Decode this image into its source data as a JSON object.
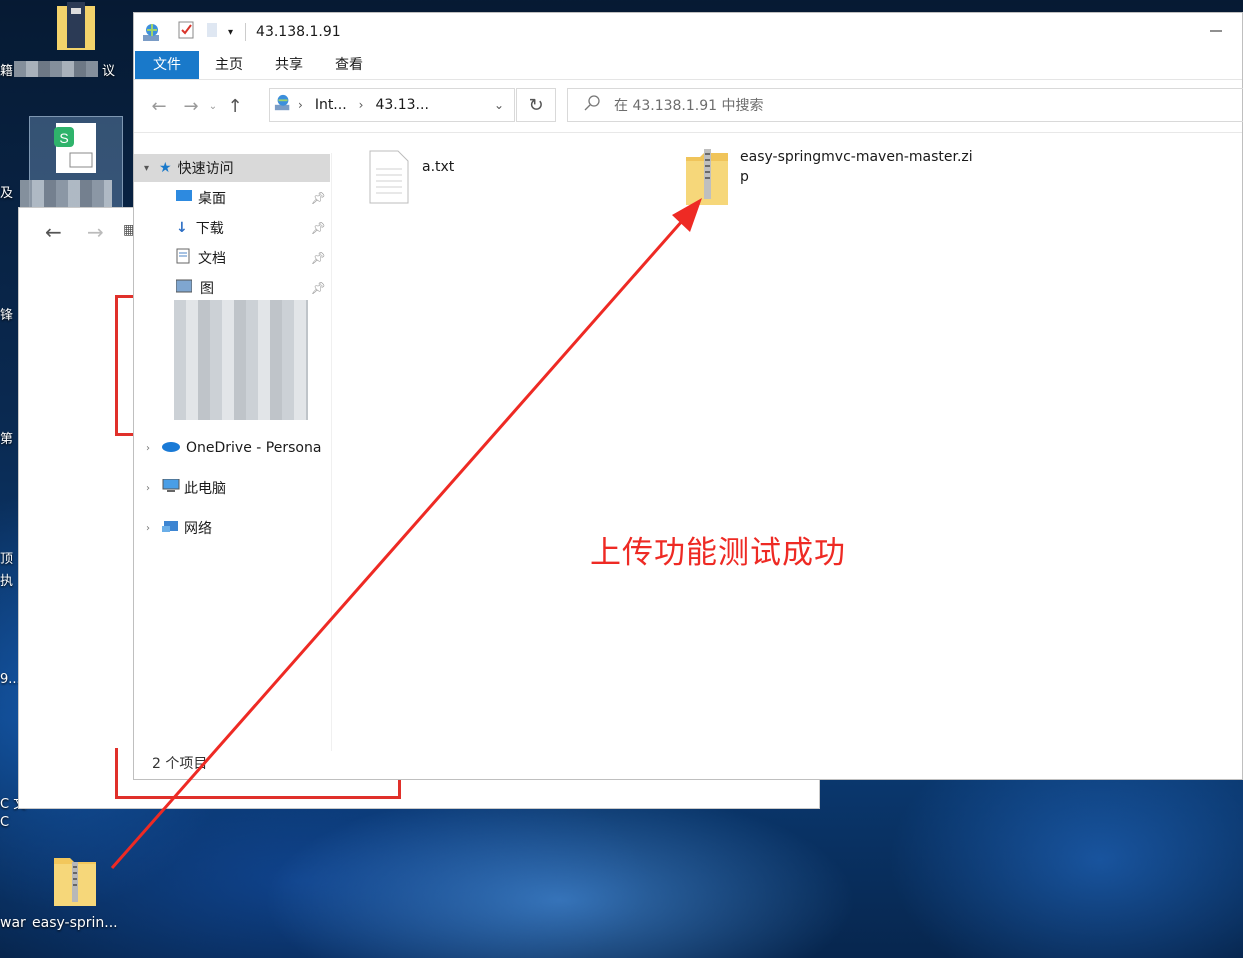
{
  "desktop": {
    "icons": [
      {
        "label": "议"
      },
      {
        "label": "easy-sprin..."
      },
      {
        "label": "war"
      }
    ],
    "edge_text": [
      "籍",
      "及",
      "锋",
      "第",
      "顶",
      "执",
      "9...",
      "C 文",
      "C"
    ]
  },
  "explorer": {
    "title": "43.138.1.91",
    "ribbon_tabs": [
      "文件",
      "主页",
      "共享",
      "查看"
    ],
    "address": {
      "segment1": "Int...",
      "segment2": "43.13..."
    },
    "search_placeholder": "在 43.138.1.91 中搜索",
    "sidebar": {
      "quick_access": "快速访问",
      "desktop": "桌面",
      "downloads": "下载",
      "documents": "文档",
      "pictures": "图",
      "onedrive": "OneDrive - Persona",
      "this_pc": "此电脑",
      "network": "网络"
    },
    "files": [
      {
        "name": "a.txt",
        "icon": "text-file-icon"
      },
      {
        "name": "easy-springmvc-maven-master.zip",
        "icon": "zip-folder-icon"
      }
    ],
    "status": "2 个项目"
  },
  "annotation": {
    "text": "上传功能测试成功",
    "color": "#ee2a24"
  }
}
